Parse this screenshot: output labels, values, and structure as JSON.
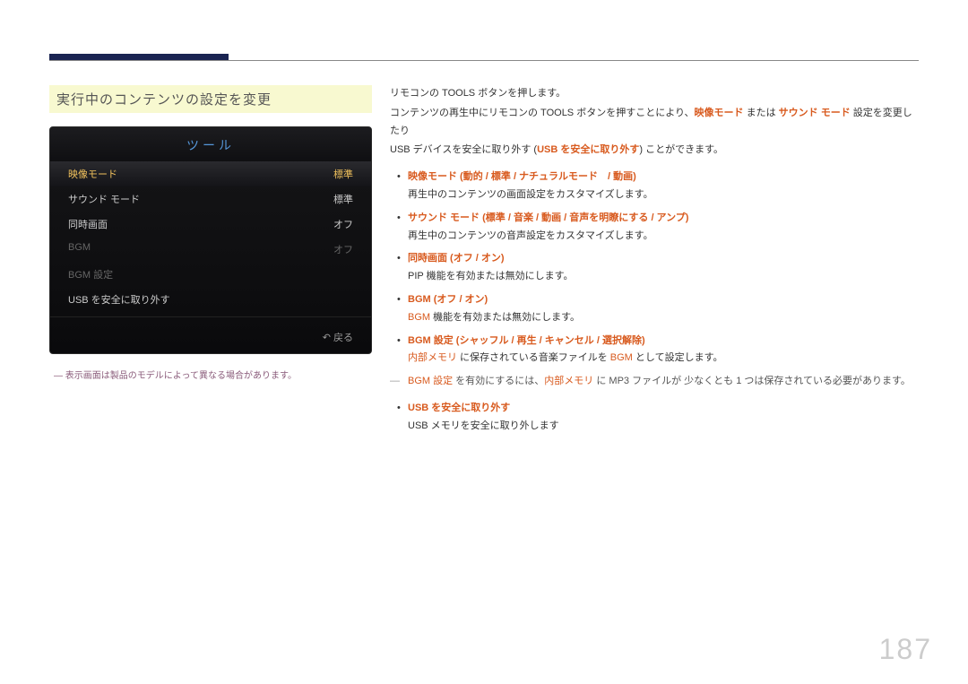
{
  "section_title": "実行中のコンテンツの設定を変更",
  "tv_menu": {
    "title": "ツール",
    "rows": [
      {
        "label": "映像モード",
        "value": "標準",
        "selected": true
      },
      {
        "label": "サウンド モード",
        "value": "標準"
      },
      {
        "label": "同時画面",
        "value": "オフ"
      },
      {
        "label": "BGM",
        "value": "オフ",
        "dim": true
      },
      {
        "label": "BGM 設定",
        "value": "",
        "dim": true
      },
      {
        "label": "USB を安全に取り外す",
        "value": ""
      }
    ],
    "footer_icon": "↶",
    "footer_label": "戻る"
  },
  "caption": "― 表示画面は製品のモデルによって異なる場合があります。",
  "right": {
    "intro1": "リモコンの TOOLS ボタンを押します。",
    "intro2_pre": "コンテンツの再生中にリモコンの TOOLS ボタンを押すことにより、",
    "intro2_h1": "映像モード",
    "intro2_mid": " または ",
    "intro2_h2": "サウンド モード",
    "intro2_post": " 設定を変更したり",
    "intro3_pre": "USB デバイスを安全に取り外す (",
    "intro3_h": "USB を安全に取り外す",
    "intro3_post": ") ことができます。",
    "items": [
      {
        "title": "映像モード (動的 / 標準 / ナチュラルモード　/ 動画)",
        "desc": "再生中のコンテンツの画面設定をカスタマイズします。"
      },
      {
        "title": "サウンド モード (標準 / 音楽 / 動画 / 音声を明瞭にする / アンプ)",
        "desc": "再生中のコンテンツの音声設定をカスタマイズします。"
      },
      {
        "title": "同時画面 (オフ / オン)",
        "desc": "PIP 機能を有効または無効にします。"
      },
      {
        "title": "BGM (オフ / オン)",
        "desc_pre": "",
        "desc_h": "BGM",
        "desc_post": " 機能を有効または無効にします。"
      },
      {
        "title": "BGM 設定 (シャッフル / 再生 / キャンセル / 選択解除)",
        "desc_h1": "内部メモリ",
        "desc_mid": " に保存されている音楽ファイルを ",
        "desc_h2": "BGM",
        "desc_post": " として設定します。"
      }
    ],
    "note": {
      "h1": "BGM 設定",
      "mid1": " を有効にするには、",
      "h2": "内部メモリ",
      "post": " に MP3 ファイルが 少なくとも 1 つは保存されている必要があります。"
    },
    "item_last": {
      "title": "USB を安全に取り外す",
      "desc": "USB メモリを安全に取り外します"
    }
  },
  "page_number": "187"
}
